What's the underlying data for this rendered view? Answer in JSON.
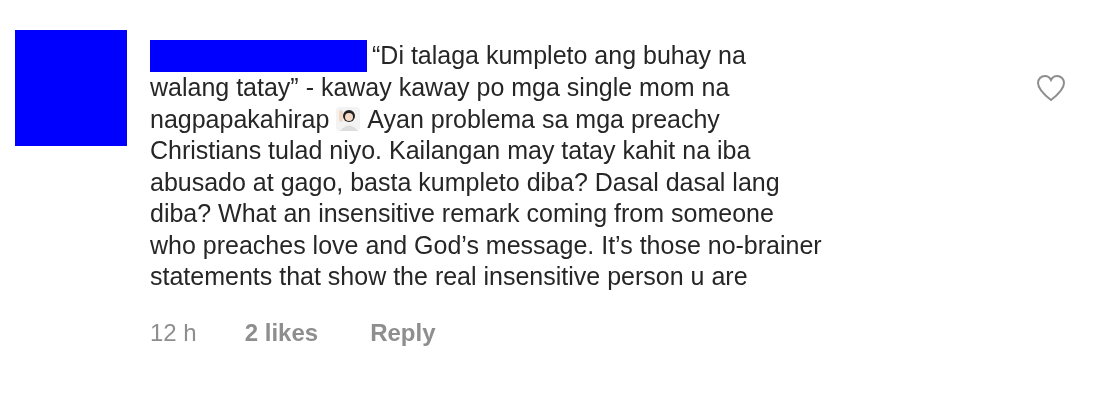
{
  "comment": {
    "lines": [
      {
        "text": "“Di talaga kumpleto ang buhay na"
      },
      {
        "text": "walang tatay” - kaway kaway po mga single mom na"
      },
      {
        "text": "nagpapakahirap",
        "text_after": "Ayan problema sa mga preachy"
      },
      {
        "text": "Christians tulad niyo. Kailangan may tatay kahit na iba"
      },
      {
        "text": "abusado at gago, basta kumpleto diba? Dasal dasal lang"
      },
      {
        "text": "diba? What an insensitive remark coming from someone"
      },
      {
        "text": "who preaches love and God’s message. It’s those no-brainer"
      },
      {
        "text": "statements that show the real insensitive person u are"
      }
    ],
    "liked": false,
    "time": "12 h",
    "likes": "2 likes",
    "reply": "Reply"
  }
}
